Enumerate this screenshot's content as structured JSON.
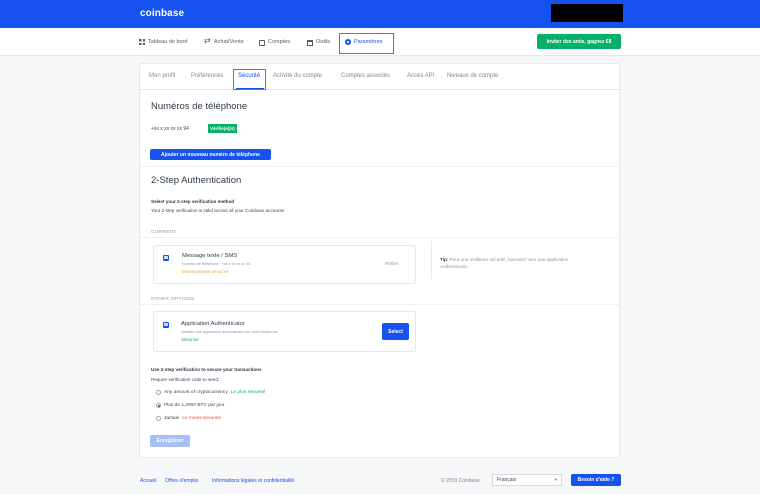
{
  "header": {
    "logo": "coinbase"
  },
  "nav": {
    "items": [
      {
        "label": "Tableau de bord",
        "icon": "dashboard-grid-icon"
      },
      {
        "label": "Achat/Vente",
        "icon": "swap-arrows-icon"
      },
      {
        "label": "Comptes",
        "icon": "briefcase-icon"
      },
      {
        "label": "Outils",
        "icon": "toolbox-icon"
      },
      {
        "label": "Paramètres",
        "icon": "gear-icon"
      }
    ],
    "invite_label": "Inviter des amis, gagnez €8"
  },
  "tabs": [
    "Mon profil",
    "Préférences",
    "Sécurité",
    "Activité du compte",
    "Comptes associés",
    "Accès API",
    "Niveaux de compte"
  ],
  "phones": {
    "title": "Numéros de téléphone",
    "number": "+xx x xx xx xx 94",
    "verified_badge": "Vérifié(e)(s)",
    "add_button": "Ajouter un nouveau numéro de téléphone"
  },
  "two_step": {
    "title": "2-Step Authentication",
    "select_heading": "Select your 2-step verification method",
    "select_sub": "Your 2-step verification is valid across all your Coinbase accounts",
    "current_label": "CURRENT",
    "current": {
      "title": "Message texte / SMS",
      "sub": "Numéro de téléphone : +xx x xx xx xx 94",
      "status": "Moyennement sécurisé",
      "action": "Retirer"
    },
    "tip_bold": "Tip:",
    "tip_text": "Pour une meilleure sécurité, basculez vers une application Authenticator.",
    "other_label": "OTHER OPTIONS",
    "other": {
      "title": "Application Authenticator",
      "sub": "Installer une application Authenticator sur votre téléphone",
      "status": "Sécurisé",
      "action": "Select"
    }
  },
  "transactions": {
    "heading": "Use 2-step verification to secure your transactions",
    "sub": "Require verification code to send:",
    "options": [
      {
        "label": "Any amount of cryptocurrency",
        "note": "Le plus sécurisé",
        "checked": false
      },
      {
        "label": "Plus de 1,2000 BTC par jour",
        "note": "",
        "checked": true
      },
      {
        "label": "Jamais",
        "note": "Le moins sécurisé",
        "checked": false
      }
    ],
    "save_button": "Enregistrer"
  },
  "footer": {
    "links": [
      "Accueil",
      "Offres d'emploi",
      "Informations légales et confidentialité"
    ],
    "copyright": "© 2019 Coinbase",
    "language": "Français",
    "help_button": "Besoin d'aide ?"
  },
  "colors": {
    "brand": "#1652f0",
    "success": "#05b169",
    "warning": "#f5a623",
    "danger": "#e64b2e"
  }
}
